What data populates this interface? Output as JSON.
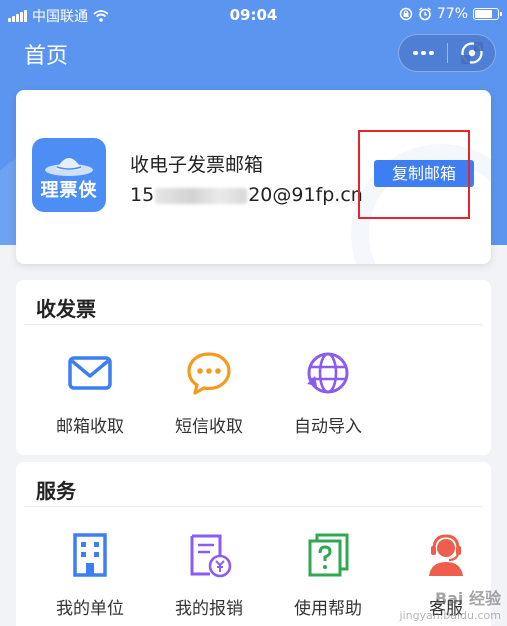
{
  "status_bar": {
    "carrier": "中国联通",
    "time": "09:04",
    "battery": "77%",
    "battery_level": 0.77
  },
  "nav": {
    "title": "首页"
  },
  "email_card": {
    "logo_text": "理票侠",
    "title": "收电子发票邮箱",
    "address_prefix": "15",
    "address_suffix": "20@91fp.cn",
    "copy_button": "复制邮箱"
  },
  "receive_section": {
    "title": "收发票",
    "items": [
      {
        "label": "邮箱收取",
        "icon": "mail-icon"
      },
      {
        "label": "短信收取",
        "icon": "sms-bubble-icon"
      },
      {
        "label": "自动导入",
        "icon": "globe-import-icon"
      }
    ]
  },
  "service_section": {
    "title": "服务",
    "items": [
      {
        "label": "我的单位",
        "icon": "building-icon"
      },
      {
        "label": "我的报销",
        "icon": "receipt-yen-icon"
      },
      {
        "label": "使用帮助",
        "icon": "help-document-icon"
      },
      {
        "label": "客服",
        "icon": "customer-service-icon"
      }
    ]
  },
  "watermark": {
    "line1": "Bai 经验",
    "line2": "jingyan.baidu.com"
  },
  "colors": {
    "primary": "#3d7ff2",
    "header_bg": "#5c95f0",
    "highlight": "#e5242b",
    "orange": "#f59a1b",
    "purple": "#8a5cf0",
    "green": "#2fa84f",
    "red": "#ef5d4d"
  }
}
